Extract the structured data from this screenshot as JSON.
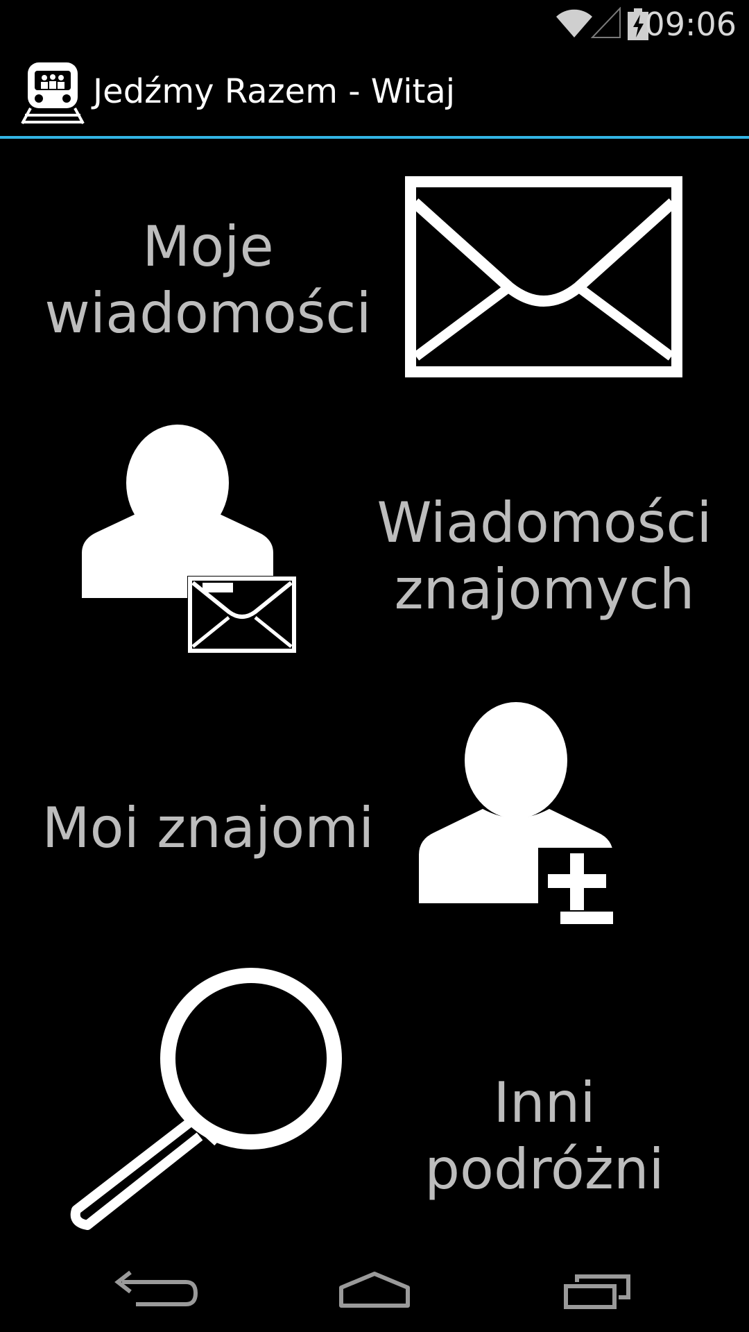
{
  "status_bar": {
    "time": "09:06",
    "icons": [
      "wifi-icon",
      "signal-icon",
      "battery-charging-icon"
    ]
  },
  "action_bar": {
    "app_icon": "train-icon",
    "title": "Jedźmy Razem - Witaj",
    "accent_color": "#33b5e5"
  },
  "tiles": [
    {
      "label_line1": "Moje",
      "label_line2": "wiadomości",
      "icon": "envelope-icon"
    },
    {
      "label_line1": "Wiadomości",
      "label_line2": "znajomych",
      "icon": "user-mail-icon"
    },
    {
      "label": "Moi znajomi",
      "icon": "user-add-icon"
    },
    {
      "label": "Inni podróżni",
      "icon": "search-icon"
    }
  ],
  "nav_bar": {
    "buttons": [
      "back-icon",
      "home-icon",
      "recent-apps-icon"
    ]
  }
}
